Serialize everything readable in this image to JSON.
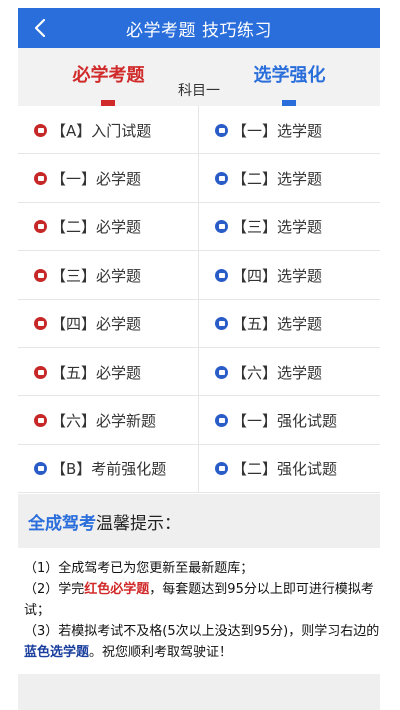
{
  "header": {
    "title": "必学考题 技巧练习",
    "back_icon": "chevron-left-icon"
  },
  "tabs": {
    "required": "必学考题",
    "optional": "选学强化",
    "subject": "科目一"
  },
  "colors": {
    "brand_blue": "#2a6edb",
    "brand_red": "#d02a2a"
  },
  "grid": {
    "rows": [
      {
        "left": {
          "text": "【A】入门试题",
          "color": "red"
        },
        "right": {
          "text": "【一】选学题",
          "color": "blue"
        }
      },
      {
        "left": {
          "text": "【一】必学题",
          "color": "red"
        },
        "right": {
          "text": "【二】选学题",
          "color": "blue"
        }
      },
      {
        "left": {
          "text": "【二】必学题",
          "color": "red"
        },
        "right": {
          "text": "【三】选学题",
          "color": "blue"
        }
      },
      {
        "left": {
          "text": "【三】必学题",
          "color": "red"
        },
        "right": {
          "text": "【四】选学题",
          "color": "blue"
        }
      },
      {
        "left": {
          "text": "【四】必学题",
          "color": "red"
        },
        "right": {
          "text": "【五】选学题",
          "color": "blue"
        }
      },
      {
        "left": {
          "text": "【五】必学题",
          "color": "red"
        },
        "right": {
          "text": "【六】选学题",
          "color": "blue"
        }
      },
      {
        "left": {
          "text": "【六】必学新题",
          "color": "red"
        },
        "right": {
          "text": "【一】强化试题",
          "color": "blue"
        }
      },
      {
        "left": {
          "text": "【B】考前强化题",
          "color": "blue"
        },
        "right": {
          "text": "【二】强化试题",
          "color": "blue"
        }
      }
    ]
  },
  "tip": {
    "brand": "全成驾考",
    "rest": "温馨提示："
  },
  "notes": {
    "line1": "（1）全成驾考已为您更新至最新题库；",
    "line2_a": "（2）学完",
    "line2_hl": "红色必学题",
    "line2_b": "，每套题达到95分以上即可进行模拟考试；",
    "line3_a": "（3）若模拟考试不及格(5次以上没达到95分)，则学习右边的",
    "line3_hl": "蓝色选学题",
    "line3_b": "。祝您顺利考取驾驶证！"
  }
}
